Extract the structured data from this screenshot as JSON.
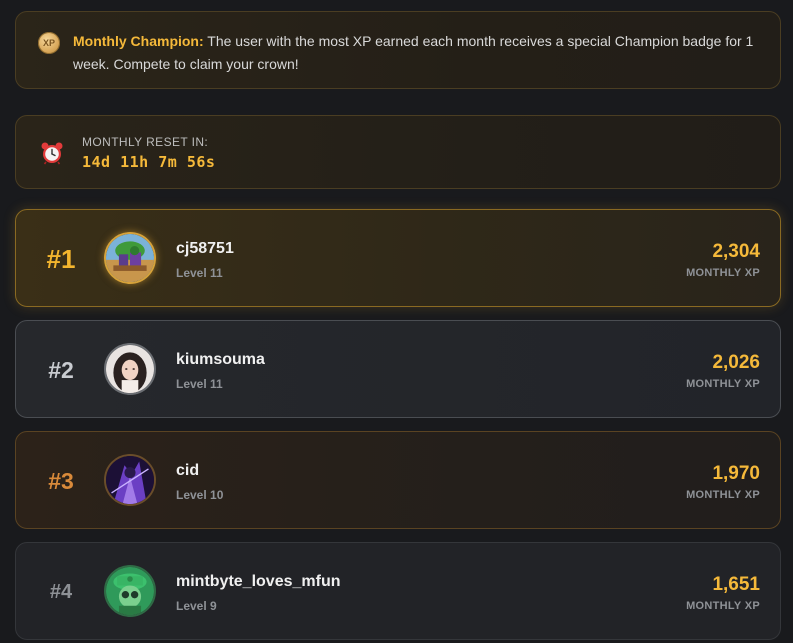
{
  "banner": {
    "icon": "xp-coin-icon",
    "icon_text": "XP",
    "title": "Monthly Champion:",
    "body": "The user with the most XP earned each month receives a special Champion badge for 1 week. Compete to claim your crown!"
  },
  "reset": {
    "icon": "alarm-clock-icon",
    "label": "MONTHLY RESET IN:",
    "countdown": "14d 11h 7m 56s"
  },
  "leaderboard": [
    {
      "rank": "#1",
      "username": "cj58751",
      "level": "Level 11",
      "xp": "2,304",
      "xp_label": "MONTHLY XP"
    },
    {
      "rank": "#2",
      "username": "kiumsouma",
      "level": "Level 11",
      "xp": "2,026",
      "xp_label": "MONTHLY XP"
    },
    {
      "rank": "#3",
      "username": "cid",
      "level": "Level 10",
      "xp": "1,970",
      "xp_label": "MONTHLY XP"
    },
    {
      "rank": "#4",
      "username": "mintbyte_loves_mfun",
      "level": "Level 9",
      "xp": "1,651",
      "xp_label": "MONTHLY XP"
    }
  ],
  "colors": {
    "accent": "#f5b93a",
    "background": "#191a1d",
    "rank1": "#f3b52e",
    "rank2": "#c9ccd1",
    "rank3": "#d98a3a",
    "rank4": "#8e9196"
  }
}
